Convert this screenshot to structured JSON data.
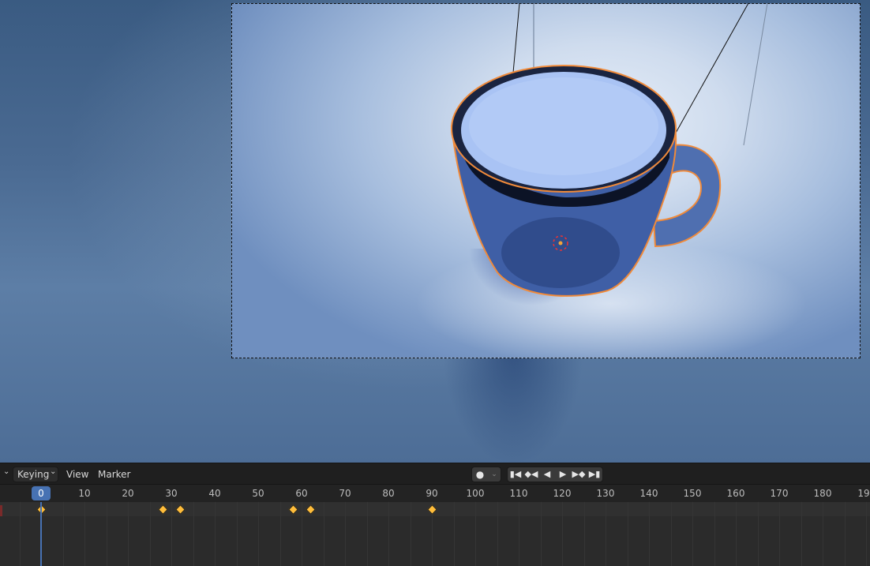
{
  "header": {
    "keying_label": "Keying",
    "view_label": "View",
    "marker_label": "Marker"
  },
  "transport": {
    "record_icon": "record-dot-icon",
    "buttons": [
      "jump-start-icon",
      "prev-keyframe-icon",
      "play-reverse-icon",
      "play-icon",
      "next-keyframe-icon",
      "jump-end-icon"
    ]
  },
  "ruler": {
    "current_frame": "0",
    "ticks": [
      "10",
      "20",
      "30",
      "40",
      "50",
      "60",
      "70",
      "80",
      "90",
      "100",
      "110",
      "120",
      "130",
      "140",
      "150",
      "160",
      "170",
      "180",
      "19"
    ]
  },
  "keyframes": [
    0,
    28,
    32,
    58,
    62,
    90
  ],
  "colors": {
    "playhead": "#4772b3",
    "keyframe": "#ffbd3b",
    "selection_outline": "#f08a3a"
  }
}
